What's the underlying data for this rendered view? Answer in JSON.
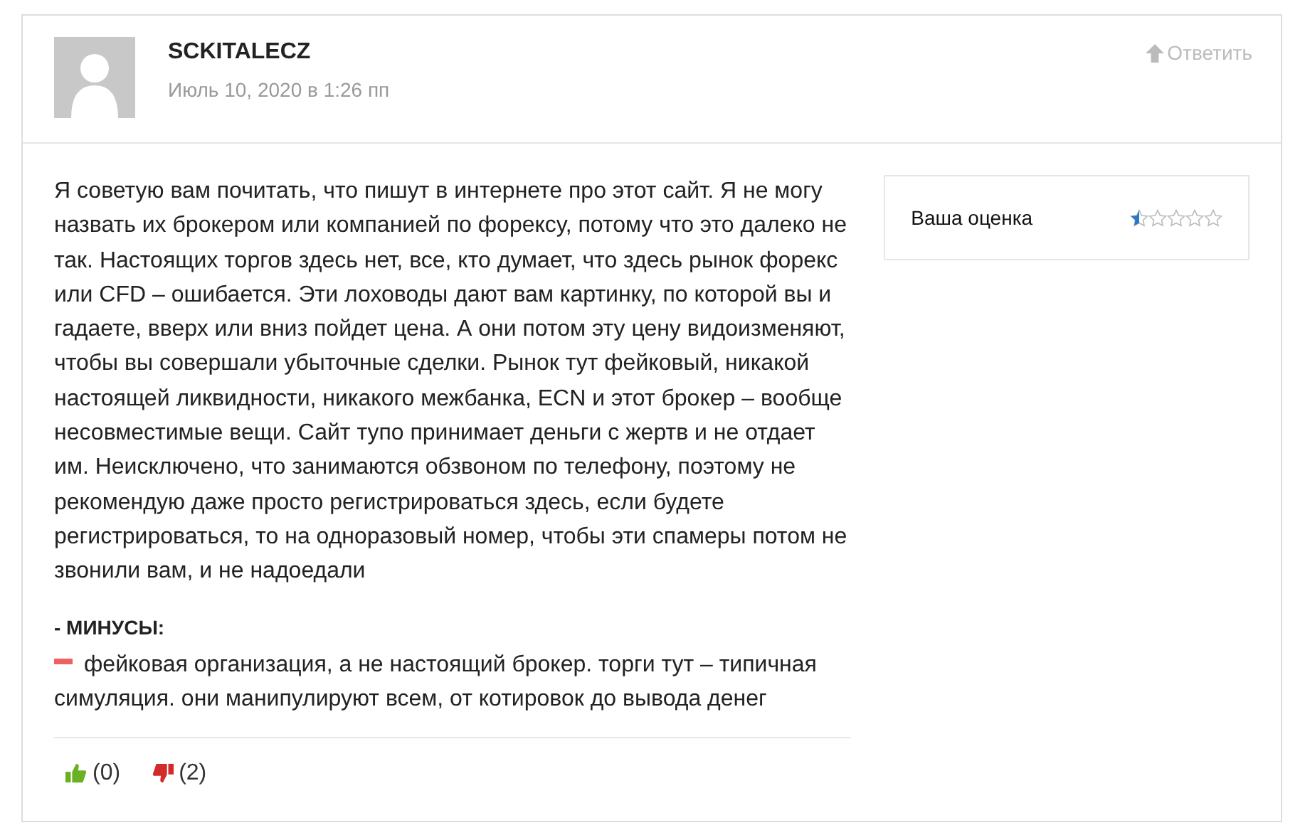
{
  "comment": {
    "author": "SCKITALECZ",
    "date": "Июль 10, 2020 в 1:26 пп",
    "reply": "Ответить",
    "text": "Я советую вам почитать, что пишут в интернете про этот сайт. Я не могу назвать их брокером или компанией по форексу, потому что это далеко не так. Настоящих торгов здесь нет, все, кто думает, что здесь рынок форекс или CFD – ошибается. Эти лоховоды дают вам картинку, по которой вы и гадаете, вверх или вниз пойдет цена. А они потом эту цену видоизменяют, чтобы вы совершали убыточные сделки. Рынок тут фейковый, никакой настоящей ликвидности, никакого межбанка, ECN и этот брокер – вообще несовместимые вещи. Сайт тупо принимает деньги с жертв и не отдает им. Неисключено, что занимаются обзвоном по телефону, поэтому не рекомендую даже просто регистрироваться здесь, если будете регистрироваться, то на одноразовый номер, чтобы эти спамеры потом не звонили вам, и не надоедали",
    "cons_title": "- МИНУСЫ:",
    "cons": [
      "фейковая организация, а не настоящий брокер. торги тут – типичная симуляция. они манипулируют всем, от котировок до вывода денег"
    ],
    "likes": "(0)",
    "dislikes": "(2)",
    "rating": {
      "label": "Ваша оценка",
      "stars": 0.5
    }
  }
}
